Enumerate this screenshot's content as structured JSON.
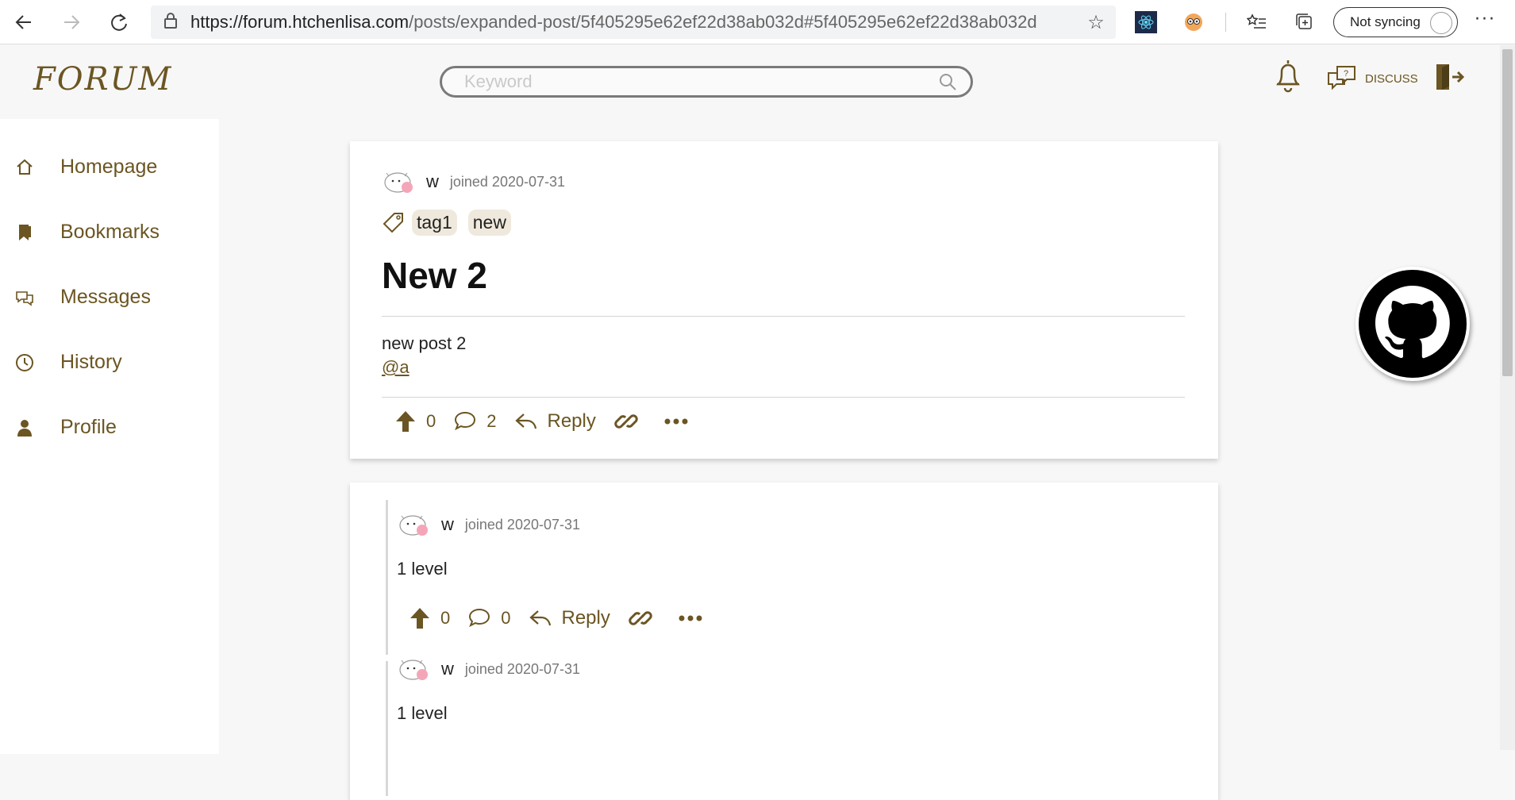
{
  "browser": {
    "url_host": "https://forum.htchenlisa.com",
    "url_path": "/posts/expanded-post/5f405295e62ef22d38ab032d#5f405295e62ef22d38ab032d",
    "sync_label": "Not syncing"
  },
  "header": {
    "logo": "FORUM",
    "search_placeholder": "Keyword",
    "discuss_label": "DISCUSS"
  },
  "sidebar": {
    "items": [
      {
        "label": "Homepage",
        "icon": "home-icon"
      },
      {
        "label": "Bookmarks",
        "icon": "bookmark-icon"
      },
      {
        "label": "Messages",
        "icon": "messages-icon"
      },
      {
        "label": "History",
        "icon": "clock-icon"
      },
      {
        "label": "Profile",
        "icon": "user-icon"
      }
    ]
  },
  "post": {
    "username": "w",
    "joined": "joined 2020-07-31",
    "tags": [
      "tag1",
      "new"
    ],
    "title": "New 2",
    "body": "new post 2",
    "mention": "@a",
    "upvotes": "0",
    "comments": "2",
    "reply_label": "Reply"
  },
  "replies": [
    {
      "username": "w",
      "joined": "joined 2020-07-31",
      "body": "1 level",
      "upvotes": "0",
      "comments": "0",
      "reply_label": "Reply"
    },
    {
      "username": "w",
      "joined": "joined 2020-07-31",
      "body": "1 level"
    }
  ],
  "colors": {
    "accent": "#6b5522",
    "tag_bg": "#efe9dd"
  }
}
